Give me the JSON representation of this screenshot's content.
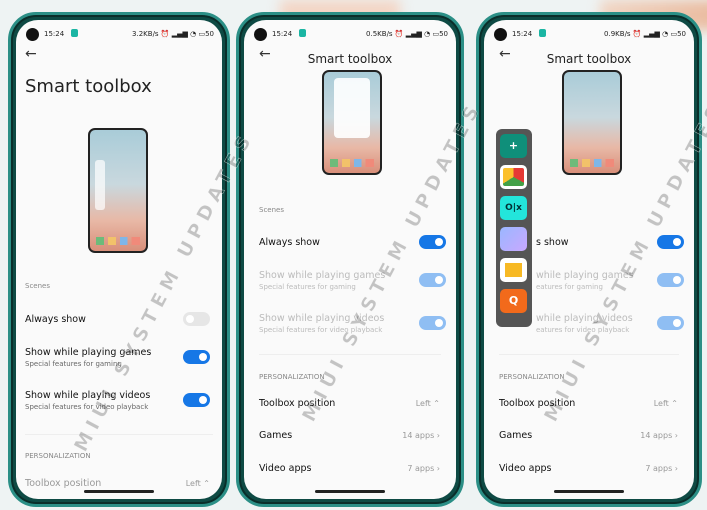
{
  "watermark": "MIUI SYSTEM UPDATES",
  "colors": {
    "accent": "#1677e6",
    "frame": "#2b8f86"
  },
  "phones": [
    {
      "status": {
        "time": "15:24",
        "speed": "3.2KB/s",
        "battery": "50"
      },
      "title": "Smart toolbox",
      "scenes": "Scenes",
      "always_show": "Always show",
      "always_show_on": false,
      "games": "Show while playing games",
      "games_sub": "Special features for gaming",
      "games_on": true,
      "videos": "Show while playing videos",
      "videos_sub": "Special features for video playback",
      "videos_on": true,
      "personalization": "PERSONALIZATION",
      "toolbox_position": "Toolbox position",
      "toolbox_position_value": "Left ⌃"
    },
    {
      "status": {
        "time": "15:24",
        "speed": "0.5KB/s",
        "battery": "50"
      },
      "title": "Smart toolbox",
      "scenes": "Scenes",
      "always_show": "Always show",
      "always_show_on": true,
      "games": "Show while playing games",
      "games_sub": "Special features for gaming",
      "videos": "Show while playing videos",
      "videos_sub": "Special features for video playback",
      "personalization": "PERSONALIZATION",
      "toolbox_position": "Toolbox position",
      "toolbox_position_value": "Left ⌃",
      "games_row": "Games",
      "games_count": "14 apps ›",
      "video_apps": "Video apps",
      "video_count": "7 apps ›"
    },
    {
      "status": {
        "time": "15:24",
        "speed": "0.9KB/s",
        "battery": "50"
      },
      "title": "Smart toolbox",
      "always_show": "s show",
      "always_show_on": true,
      "games": "while playing games",
      "games_sub": "eatures for gaming",
      "videos": "while playing videos",
      "videos_sub": "eatures for video playback",
      "personalization": "PERSONALIZATION",
      "toolbox_position": "Toolbox position",
      "toolbox_position_value": "Left ⌃",
      "games_row": "Games",
      "games_count": "14 apps ›",
      "video_apps": "Video apps",
      "video_count": "7 apps ›",
      "toolbox_apps": [
        {
          "icon": "add-icon",
          "label": "+"
        },
        {
          "icon": "chrome-icon",
          "label": ""
        },
        {
          "icon": "olx-icon",
          "label": "O|x"
        },
        {
          "icon": "gallery-icon",
          "label": ""
        },
        {
          "icon": "file-manager-icon",
          "label": ""
        },
        {
          "icon": "quick-app-icon",
          "label": "Q"
        }
      ]
    }
  ]
}
